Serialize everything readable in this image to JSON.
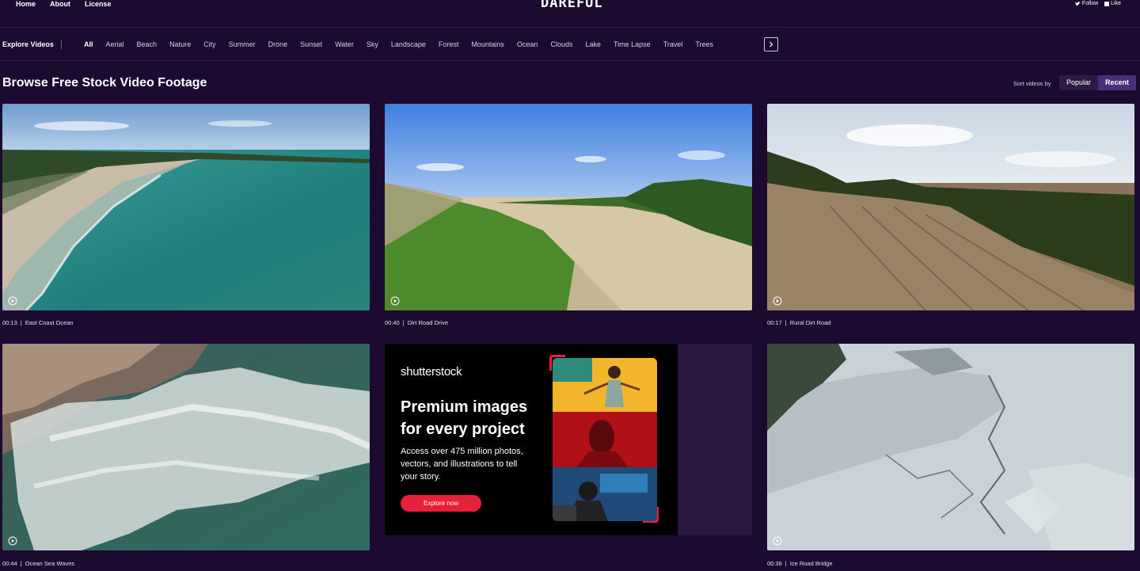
{
  "topnav": {
    "links": [
      "Home",
      "About",
      "License"
    ]
  },
  "logo": {
    "text": "DAREFUL"
  },
  "social": {
    "follow": "Follow",
    "like": "Like"
  },
  "categories": {
    "label": "Explore Videos",
    "items": [
      "All",
      "Aerial",
      "Beach",
      "Nature",
      "City",
      "Summer",
      "Drone",
      "Sunset",
      "Water",
      "Sky",
      "Landscape",
      "Forest",
      "Mountains",
      "Ocean",
      "Clouds",
      "Lake",
      "Time Lapse",
      "Travel",
      "Trees"
    ],
    "active": "All"
  },
  "browse": {
    "title": "Browse Free Stock Video Footage",
    "sort_label": "Sort videos by",
    "sort_options": [
      "Popular",
      "Recent"
    ],
    "sort_active": "Recent"
  },
  "videos": [
    {
      "duration": "00:13",
      "title": "East Coast Ocean"
    },
    {
      "duration": "00:40",
      "title": "Dirt Road Drive"
    },
    {
      "duration": "00:17",
      "title": "Rural Dirt Road"
    },
    {
      "duration": "00:44",
      "title": "Ocean Sea Waves"
    },
    {
      "duration": "00:36",
      "title": "Ice Road Bridge"
    }
  ],
  "ad": {
    "brand": "shutterstock",
    "headline": "Premium images for every project",
    "body": "Access over 475 million photos, vectors, and illustrations to tell your story.",
    "cta": "Explore now"
  },
  "colors": {
    "background": "#1c0a30",
    "accent": "#4b2d7a",
    "ad_red": "#e8213a"
  }
}
